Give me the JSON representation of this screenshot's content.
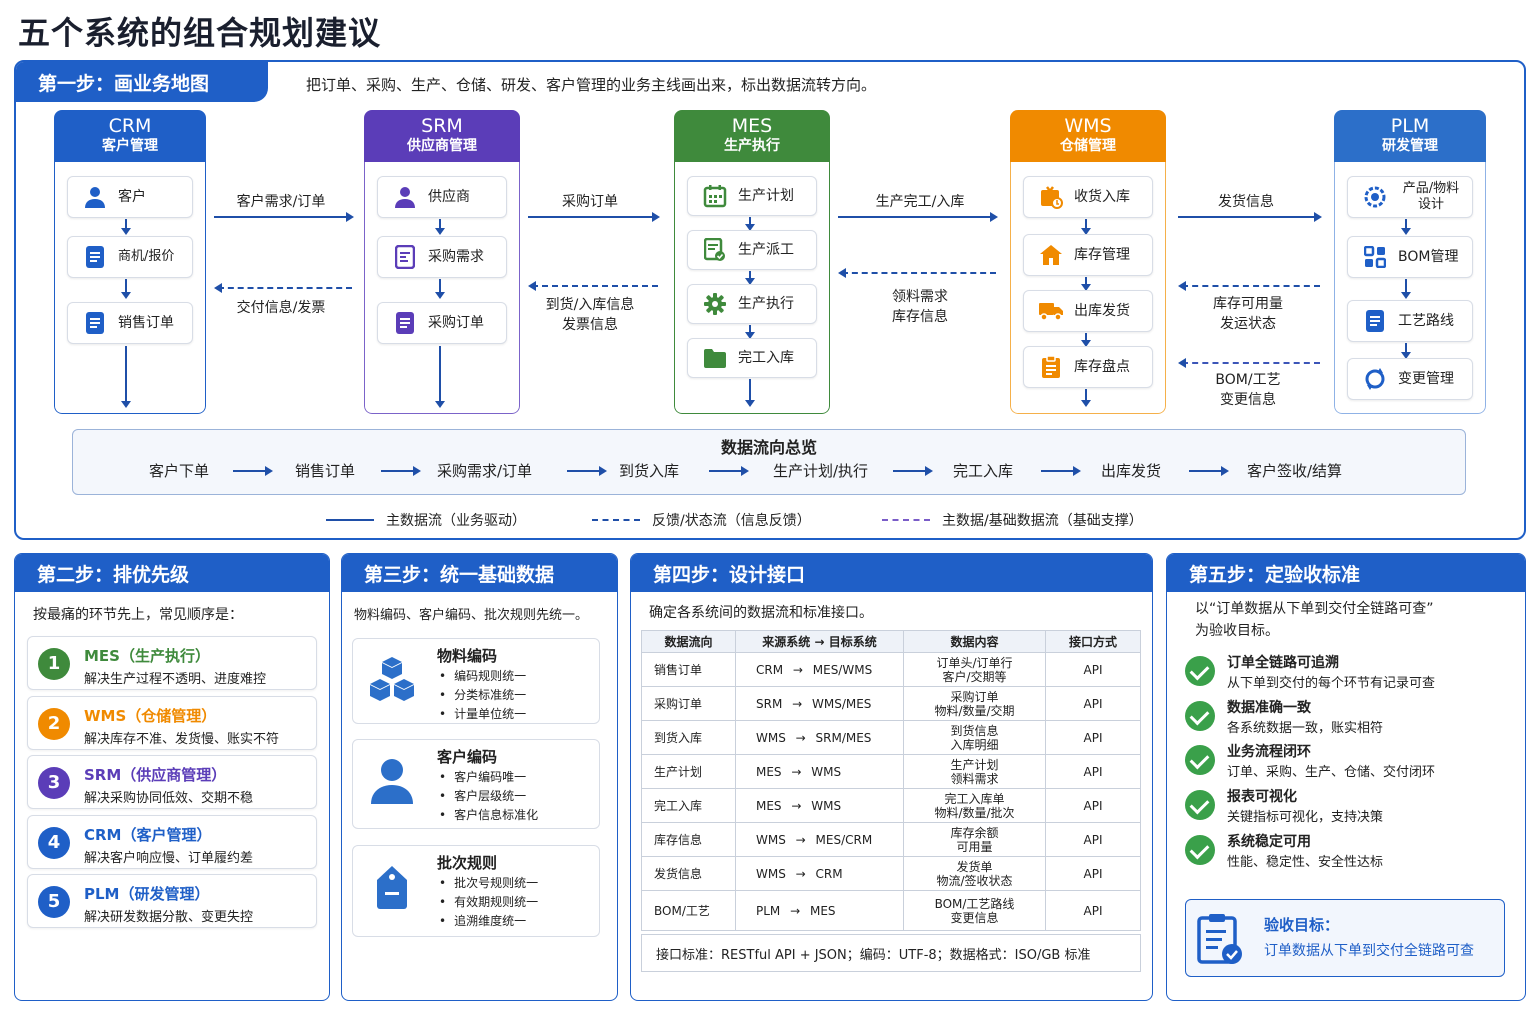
{
  "title": "五个系统的组合规划建议",
  "step1": {
    "header": "第一步：画业务地图",
    "desc": "把订单、采购、生产、仓储、研发、客户管理的业务主线画出来，标出数据流转方向。",
    "systems": [
      {
        "name": "CRM",
        "sub": "客户管理",
        "color": "#1f5fc7",
        "nodes": [
          "客户",
          "商机/报价",
          "销售订单"
        ]
      },
      {
        "name": "SRM",
        "sub": "供应商管理",
        "color": "#5b3db8",
        "nodes": [
          "供应商",
          "采购需求",
          "采购订单"
        ]
      },
      {
        "name": "MES",
        "sub": "生产执行",
        "color": "#3f8a3c",
        "nodes": [
          "生产计划",
          "生产派工",
          "生产执行",
          "完工入库"
        ]
      },
      {
        "name": "WMS",
        "sub": "仓储管理",
        "color": "#f08a00",
        "nodes": [
          "收货入库",
          "库存管理",
          "出库发货",
          "库存盘点"
        ]
      },
      {
        "name": "PLM",
        "sub": "研发管理",
        "color": "#2c6fc9",
        "nodes": [
          "产品/物料设计",
          "BOM管理",
          "工艺路线",
          "变更管理"
        ]
      }
    ],
    "flows": {
      "crm_srm_fwd": "客户需求/订单",
      "crm_srm_back": "交付信息/发票",
      "srm_mes_fwd": "采购订单",
      "srm_mes_back1": "到货/入库信息",
      "srm_mes_back2": "发票信息",
      "mes_wms_fwd": "生产完工/入库",
      "mes_wms_back1": "领料需求",
      "mes_wms_back2": "库存信息",
      "wms_plm_fwd": "发货信息",
      "wms_plm_back1": "库存可用量",
      "wms_plm_back2": "发运状态",
      "wms_plm_back3": "BOM/工艺",
      "wms_plm_back4": "变更信息"
    },
    "overview": {
      "title": "数据流向总览",
      "items": [
        "客户下单",
        "销售订单",
        "采购需求/订单",
        "到货入库",
        "生产计划/执行",
        "完工入库",
        "出库发货",
        "客户签收/结算"
      ]
    },
    "legend": [
      "主数据流（业务驱动）",
      "反馈/状态流（信息反馈）",
      "主数据/基础数据流（基础支撑）"
    ]
  },
  "step2": {
    "header": "第二步：排优先级",
    "intro": "按最痛的环节先上，常见顺序是：",
    "items": [
      {
        "num": "1",
        "title": "MES（生产执行）",
        "desc": "解决生产过程不透明、进度难控",
        "color": "#3f8a3c"
      },
      {
        "num": "2",
        "title": "WMS（仓储管理）",
        "desc": "解决库存不准、发货慢、账实不符",
        "color": "#f08a00"
      },
      {
        "num": "3",
        "title": "SRM（供应商管理）",
        "desc": "解决采购协同低效、交期不稳",
        "color": "#5b3db8"
      },
      {
        "num": "4",
        "title": "CRM（客户管理）",
        "desc": "解决客户响应慢、订单履约差",
        "color": "#1f5fc7"
      },
      {
        "num": "5",
        "title": "PLM（研发管理）",
        "desc": "解决研发数据分散、变更失控",
        "color": "#1f5fc7"
      }
    ]
  },
  "step3": {
    "header": "第三步：统一基础数据",
    "intro": "物料编码、客户编码、批次规则先统一。",
    "blocks": [
      {
        "title": "物料编码",
        "items": [
          "编码规则统一",
          "分类标准统一",
          "计量单位统一"
        ]
      },
      {
        "title": "客户编码",
        "items": [
          "客户编码唯一",
          "客户层级统一",
          "客户信息标准化"
        ]
      },
      {
        "title": "批次规则",
        "items": [
          "批次号规则统一",
          "有效期规则统一",
          "追溯维度统一"
        ]
      }
    ]
  },
  "step4": {
    "header": "第四步：设计接口",
    "intro": "确定各系统间的数据流和标准接口。",
    "columns": [
      "数据流向",
      "来源系统 → 目标系统",
      "数据内容",
      "接口方式"
    ],
    "rows": [
      [
        "销售订单",
        "CRM → MES/WMS",
        "订单头/订单行",
        "客户/交期等",
        "API"
      ],
      [
        "采购订单",
        "SRM → WMS/MES",
        "采购订单",
        "物料/数量/交期",
        "API"
      ],
      [
        "到货入库",
        "WMS → SRM/MES",
        "到货信息",
        "入库明细",
        "API"
      ],
      [
        "生产计划",
        "MES → WMS",
        "生产计划",
        "领料需求",
        "API"
      ],
      [
        "完工入库",
        "MES → WMS",
        "完工入库单",
        "物料/数量/批次",
        "API"
      ],
      [
        "库存信息",
        "WMS → MES/CRM",
        "库存余额",
        "可用量",
        "API"
      ],
      [
        "发货信息",
        "WMS → CRM",
        "发货单",
        "物流/签收状态",
        "API"
      ],
      [
        "BOM/工艺",
        "PLM → MES",
        "BOM/工艺路线",
        "变更信息",
        "API"
      ]
    ],
    "note": "接口标准：RESTful API + JSON；编码：UTF-8；数据格式：ISO/GB 标准"
  },
  "step5": {
    "header": "第五步：定验收标准",
    "intro1": "以“订单数据从下单到交付全链路可查”",
    "intro2": "为验收目标。",
    "items": [
      {
        "title": "订单全链路可追溯",
        "desc": "从下单到交付的每个环节有记录可查"
      },
      {
        "title": "数据准确一致",
        "desc": "各系统数据一致，账实相符"
      },
      {
        "title": "业务流程闭环",
        "desc": "订单、采购、生产、仓储、交付闭环"
      },
      {
        "title": "报表可视化",
        "desc": "关键指标可视化，支持决策"
      },
      {
        "title": "系统稳定可用",
        "desc": "性能、稳定性、安全性达标"
      }
    ],
    "goal_title": "验收目标：",
    "goal_desc": "订单数据从下单到交付全链路可查"
  }
}
